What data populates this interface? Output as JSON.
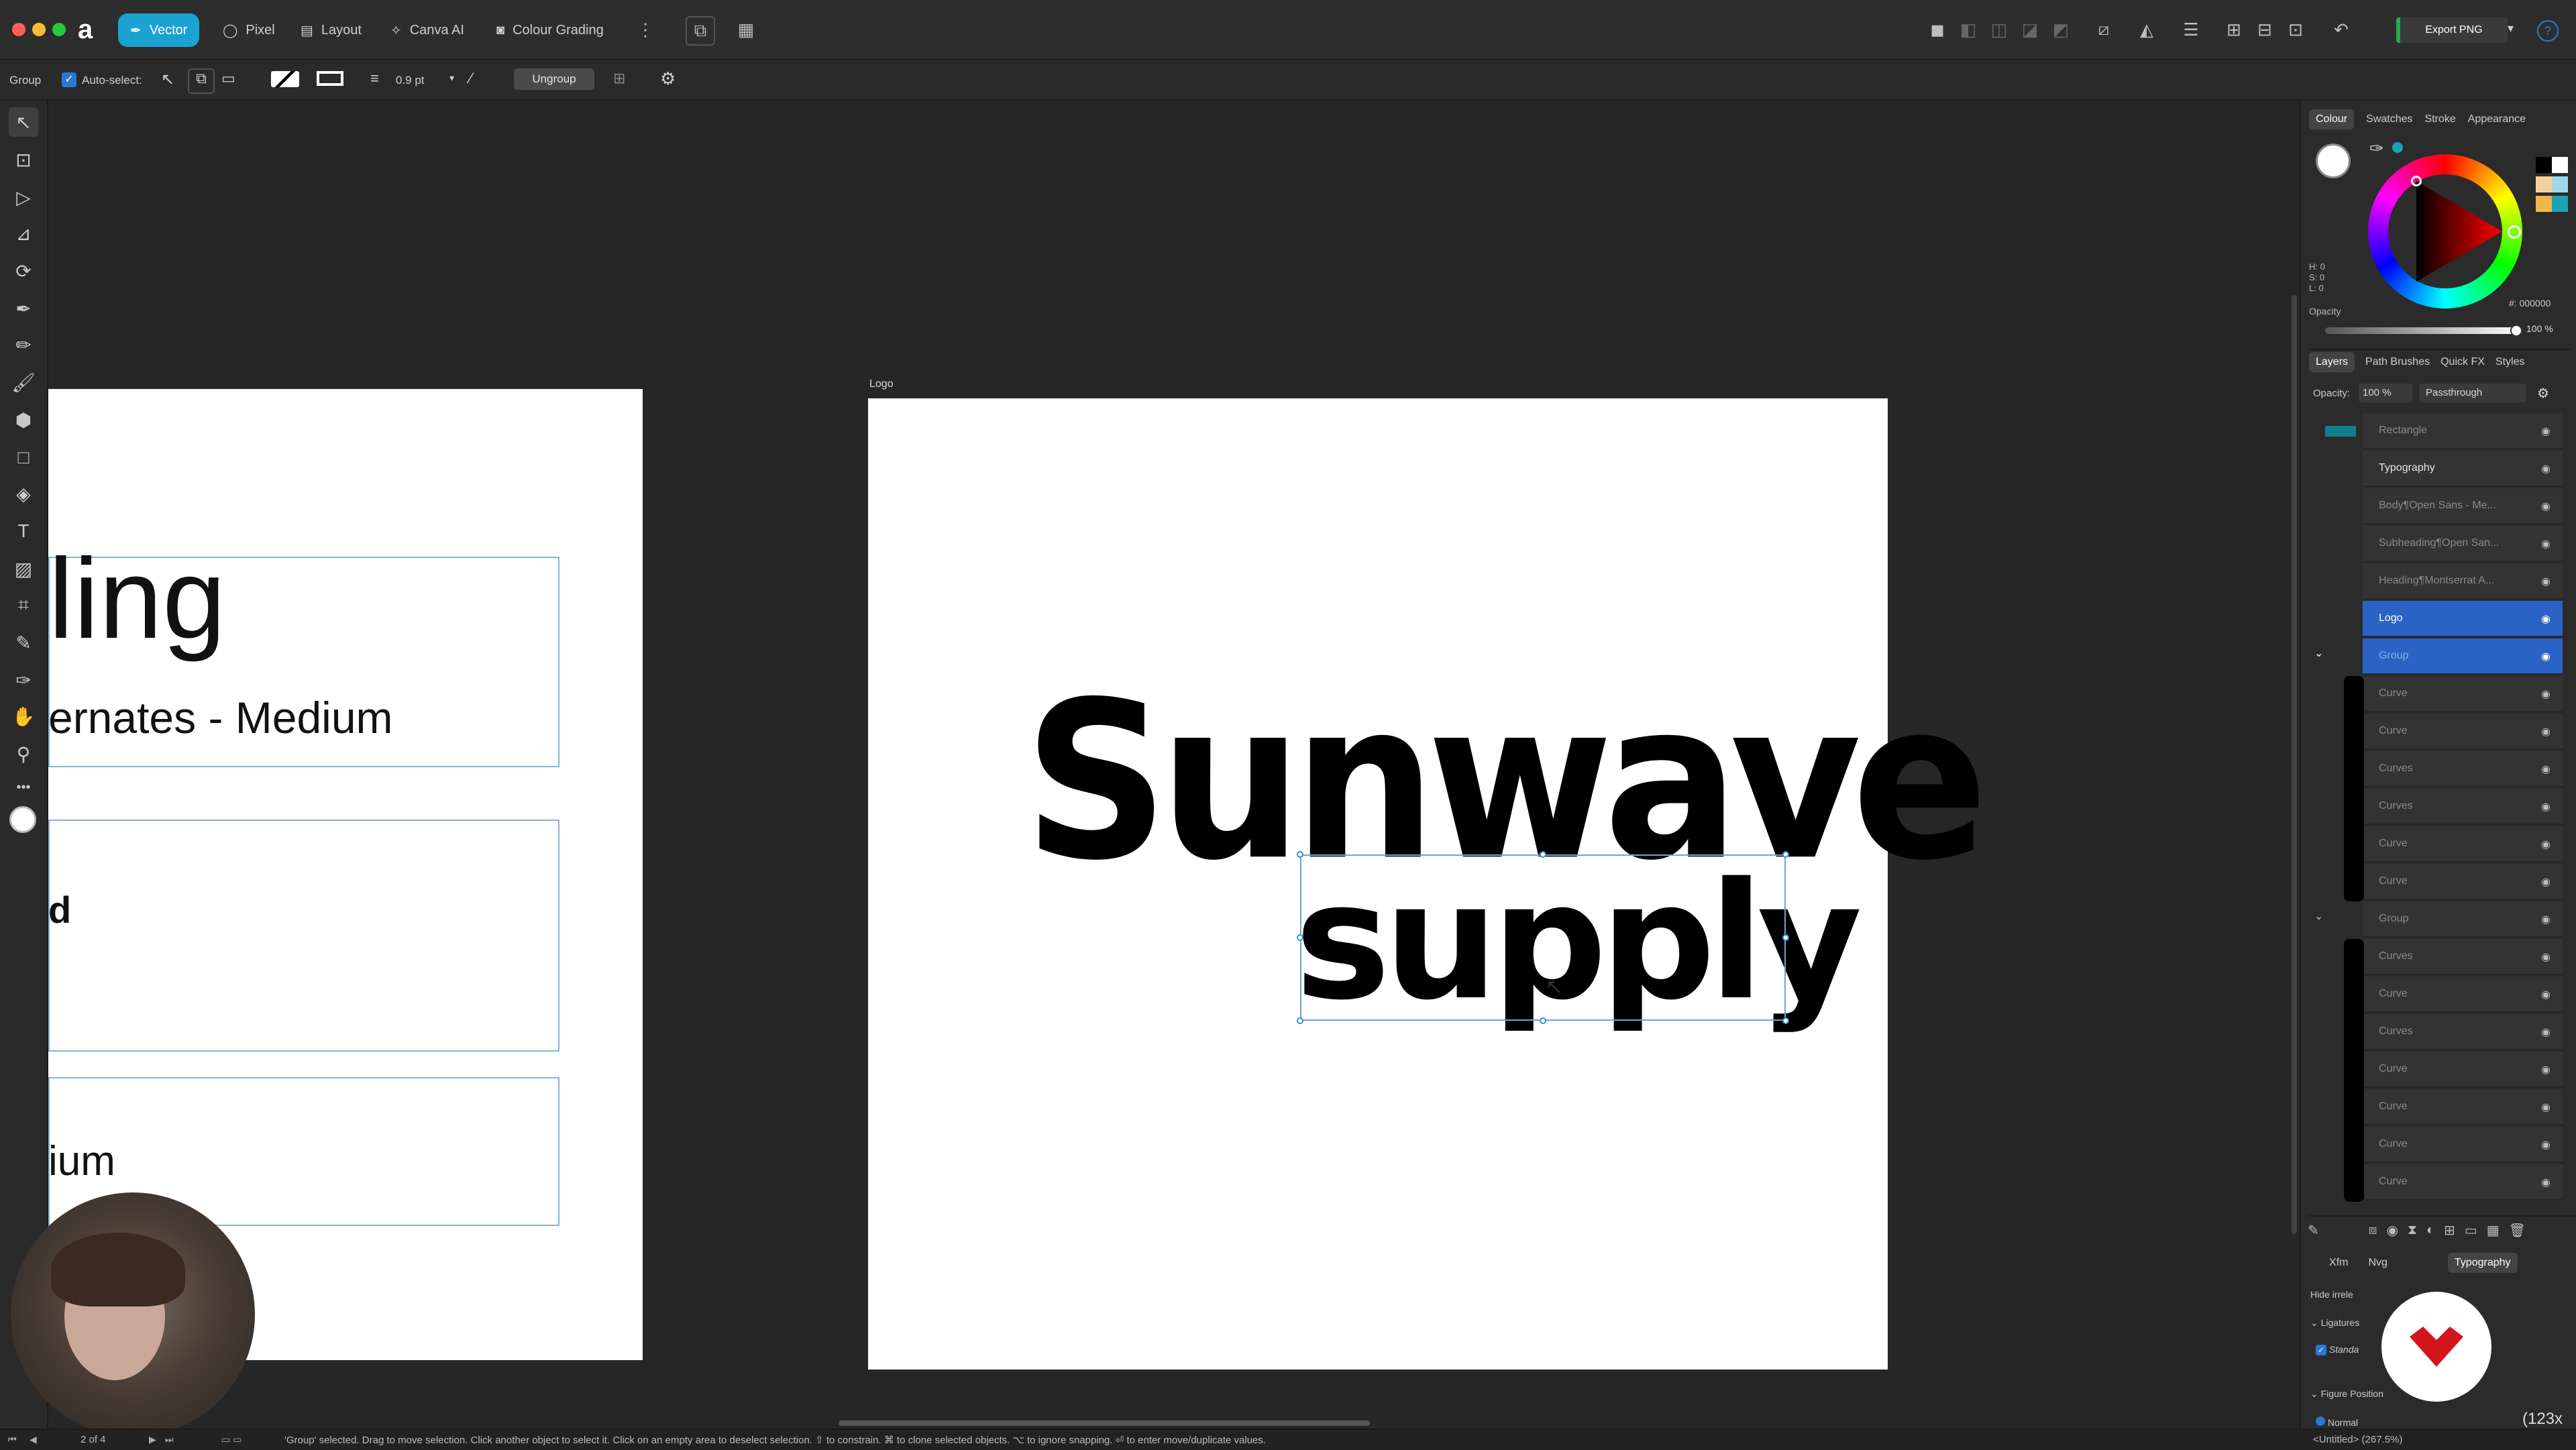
{
  "personas": [
    {
      "label": "Vector",
      "active": true
    },
    {
      "label": "Pixel"
    },
    {
      "label": "Layout"
    },
    {
      "label": "Canva AI"
    },
    {
      "label": "Colour Grading"
    }
  ],
  "export_label": "Export PNG",
  "context": {
    "group_label": "Group",
    "auto_select_label": "Auto-select:",
    "stroke_width": "0.9 pt",
    "ungroup_label": "Ungroup"
  },
  "canvas": {
    "artboard_label": "Logo",
    "logo_line1": "Sunwave",
    "logo_line2": "supply",
    "left_texts": {
      "heading": "ling",
      "subheading": "ernates - Medium",
      "body_fragment": "d",
      "medium_fragment": "ium"
    }
  },
  "colour_panel": {
    "tabs": [
      "Colour",
      "Swatches",
      "Stroke",
      "Appearance"
    ],
    "hsl": {
      "h": "H: 0",
      "s": "S: 0",
      "l": "L: 0"
    },
    "opacity_label": "Opacity",
    "opacity_value": "100 %",
    "hex": "#: 000000"
  },
  "layers_panel": {
    "tabs": [
      "Layers",
      "Path Brushes",
      "Quick FX",
      "Styles"
    ],
    "opacity_label": "Opacity:",
    "opacity_value": "100 %",
    "blend_mode": "Passthrough",
    "rows": [
      {
        "label": "Rectangle"
      },
      {
        "label": "Typography",
        "strong": true
      },
      {
        "label": "Body¶Open Sans - Me..."
      },
      {
        "label": "Subheading¶Open San..."
      },
      {
        "label": "Heading¶Montserrat A..."
      },
      {
        "label": "Logo",
        "sel": true
      },
      {
        "label": "Group",
        "sel": true
      },
      {
        "label": "Curve"
      },
      {
        "label": "Curve"
      },
      {
        "label": "Curves"
      },
      {
        "label": "Curves"
      },
      {
        "label": "Curve"
      },
      {
        "label": "Curve"
      },
      {
        "label": "Group"
      },
      {
        "label": "Curves"
      },
      {
        "label": "Curve"
      },
      {
        "label": "Curves"
      },
      {
        "label": "Curve"
      },
      {
        "label": "Curve"
      },
      {
        "label": "Curve"
      },
      {
        "label": "Curve"
      }
    ]
  },
  "bottom_panel": {
    "tabs": [
      "Xfm",
      "Nvg",
      "Typography"
    ],
    "hide_label": "Hide irrele",
    "ligatures_label": "Ligatures",
    "standard_label": "Standa",
    "figure_position_label": "Figure Position",
    "normal_label": "Normal",
    "zoom_readout": "(123x"
  },
  "status": {
    "page_indicator": "2 of 4",
    "message": "'Group' selected. Drag to move selection. Click another object to select it. Click on an empty area to deselect selection. ⇧ to constrain. ⌘ to clone selected objects. ⌥ to ignore snapping. ⏎ to enter move/duplicate values.",
    "doc_title": "<Untitled> (267.5%)"
  }
}
